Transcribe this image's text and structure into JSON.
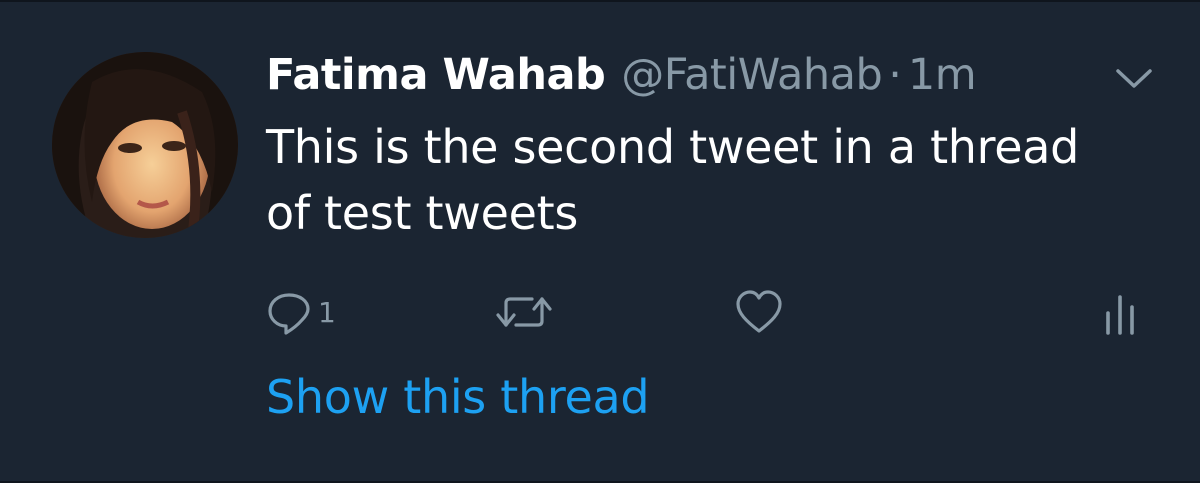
{
  "tweet": {
    "author_name": "Fatima Wahab",
    "author_handle": "@FatiWahab",
    "separator": "·",
    "timestamp": "1m",
    "text": "This is the second tweet in a thread of test tweets",
    "reply_count": "1",
    "show_thread_label": "Show this thread"
  },
  "icons": {
    "menu": "chevron-down-icon",
    "reply": "reply-icon",
    "retweet": "retweet-icon",
    "like": "heart-icon",
    "analytics": "analytics-icon"
  },
  "colors": {
    "background": "#1b2532",
    "primary_text": "#ffffff",
    "secondary_text": "#8899a6",
    "link": "#1da1f2"
  }
}
